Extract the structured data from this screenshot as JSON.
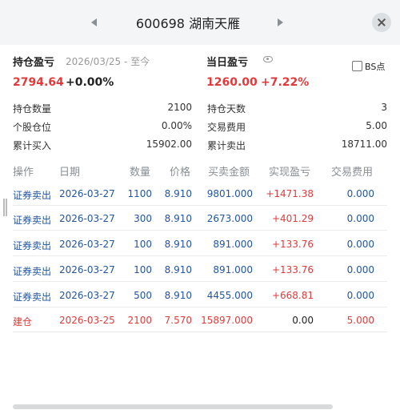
{
  "header": {
    "title": "600698 湖南天雁"
  },
  "summary": {
    "position_pl_label": "持仓盈亏",
    "date_range": "2026/03/25 - 至今",
    "position_pl_value": "2794.64",
    "position_pl_pct": "+0.00%",
    "daily_pl_label": "当日盈亏",
    "daily_pl_value": "1260.00",
    "daily_pl_pct": "+7.22%",
    "bs_label": "BS点"
  },
  "stats": {
    "left": [
      {
        "label": "持仓数量",
        "value": "2100"
      },
      {
        "label": "个股仓位",
        "value": "0.00%"
      },
      {
        "label": "累计买入",
        "value": "15902.00"
      }
    ],
    "right": [
      {
        "label": "持仓天数",
        "value": "3"
      },
      {
        "label": "交易费用",
        "value": "5.00"
      },
      {
        "label": "累计卖出",
        "value": "18711.00"
      }
    ]
  },
  "table": {
    "headers": [
      "操作",
      "日期",
      "数量",
      "价格",
      "买卖金额",
      "实现盈亏",
      "交易费用"
    ],
    "rows": [
      [
        "证券卖出",
        "2026-03-27",
        "1100",
        "8.910",
        "9801.000",
        "+1471.38",
        "0.000"
      ],
      [
        "证券卖出",
        "2026-03-27",
        "300",
        "8.910",
        "2673.000",
        "+401.29",
        "0.000"
      ],
      [
        "证券卖出",
        "2026-03-27",
        "100",
        "8.910",
        "891.000",
        "+133.76",
        "0.000"
      ],
      [
        "证券卖出",
        "2026-03-27",
        "100",
        "8.910",
        "891.000",
        "+133.76",
        "0.000"
      ],
      [
        "证券卖出",
        "2026-03-27",
        "500",
        "8.910",
        "4455.000",
        "+668.81",
        "0.000"
      ],
      [
        "建仓",
        "2026-03-25",
        "2100",
        "7.570",
        "15897.000",
        "0.00",
        "5.000"
      ]
    ]
  },
  "colors": {
    "up": "#e23a3a",
    "link": "#2255a4",
    "muted": "#8a8f94"
  },
  "icons": [
    "chevron-left-icon",
    "chevron-right-icon",
    "close-icon",
    "eye-icon",
    "checkbox-icon"
  ]
}
